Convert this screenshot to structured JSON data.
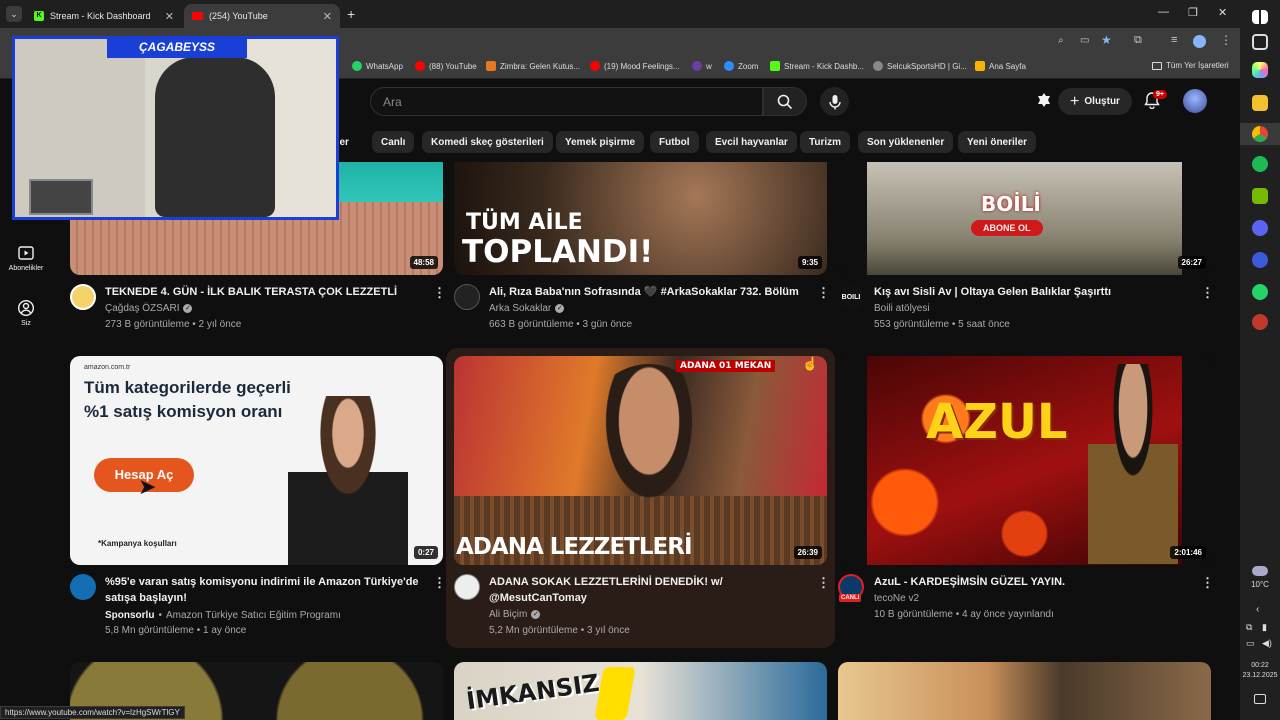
{
  "browser": {
    "tabs": [
      {
        "label": "Stream - Kick Dashboard"
      },
      {
        "label": "(254) YouTube"
      }
    ],
    "bookmarks": [
      {
        "label": "WhatsApp"
      },
      {
        "label": "(88) YouTube"
      },
      {
        "label": "Zimbra: Gelen Kutus..."
      },
      {
        "label": "(19) Mood Feelings..."
      },
      {
        "label": "w"
      },
      {
        "label": "Zoom"
      },
      {
        "label": "Stream - Kick Dashb..."
      },
      {
        "label": "SelcukSportsHD | Gi..."
      },
      {
        "label": "Ana Sayfa"
      }
    ],
    "all_bookmarks": "Tüm Yer İşaretleri",
    "status_url": "https://www.youtube.com/watch?v=lzHgSWrTlGY"
  },
  "webcam": {
    "name": "ÇAGABEYSS"
  },
  "youtube": {
    "search_placeholder": "Ara",
    "create_label": "Oluştur",
    "notif_badge": "9+",
    "sidebar": [
      {
        "label": "Abonelikler",
        "icon": "subscriptions-icon"
      },
      {
        "label": "Siz",
        "icon": "you-icon"
      }
    ],
    "chips": [
      "...'ler",
      "Canlı",
      "Komedi skeç gösterileri",
      "Yemek pişirme",
      "Futbol",
      "Evcil hayvanlar",
      "Turizm",
      "Son yüklenenler",
      "Yeni öneriler"
    ],
    "videos": [
      {
        "title": "TEKNEDE 4. GÜN -  İLK BALIK TERASTA ÇOK LEZZETLİ",
        "channel": "Çağdaş ÖZSARI",
        "meta": "273 B görüntüleme • 2 yıl önce",
        "duration": "48:58"
      },
      {
        "title": "Ali, Rıza Baba'nın Sofrasında 🖤 #ArkaSokaklar 732. Bölüm",
        "channel": "Arka Sokaklar",
        "meta": "663 B görüntüleme • 3 gün önce",
        "duration": "9:35",
        "overlay": [
          "TÜM AİLE",
          "TOPLANDI!"
        ]
      },
      {
        "title": "Kış avı Sisli Av | Oltaya Gelen Balıklar Şaşırttı",
        "channel": "Boili atölyesi",
        "meta": "553 görüntüleme • 5 saat önce",
        "duration": "26:27",
        "overlay": [
          "BOİLİ",
          "ABONE OL"
        ],
        "avatar_text": "BOILI"
      },
      {
        "title": "%95'e varan satış komisyonu indirimi ile Amazon Türkiye'de satışa başlayın!",
        "channel": "Amazon Türkiye Satıcı Eğitim Programı",
        "sponsored": "Sponsorlu",
        "meta": "5,8 Mn görüntüleme • 1 ay önce",
        "duration": "0:27",
        "overlay": [
          "amazon.com.tr",
          "Tüm kategorilerde geçerli",
          "%1 satış komisyon oranı",
          "Hesap Aç",
          "*Kampanya koşulları"
        ]
      },
      {
        "title": "ADANA SOKAK LEZZETLERİNİ DENEDİK! w/ @MesutCanTomay",
        "channel": "Ali Biçim",
        "meta": "5,2 Mn görüntüleme • 3 yıl önce",
        "duration": "26:39",
        "overlay": [
          "ADANA LEZZETLERİ",
          "ADANA 01 MEKAN"
        ]
      },
      {
        "title": "AzuL  - KARDEŞİMSİN GÜZEL YAYIN.",
        "channel": "tecoNe v2",
        "meta": "10 B görüntüleme • 4 ay önce yayınlandı",
        "duration": "2:01:46",
        "overlay": [
          "AZUL"
        ],
        "live_badge": "CANLI"
      }
    ],
    "next_row_overlay": "İMKANSIZ"
  },
  "taskbar": {
    "weather": "10°C",
    "time": "00:22",
    "date": "23.12.2025"
  }
}
